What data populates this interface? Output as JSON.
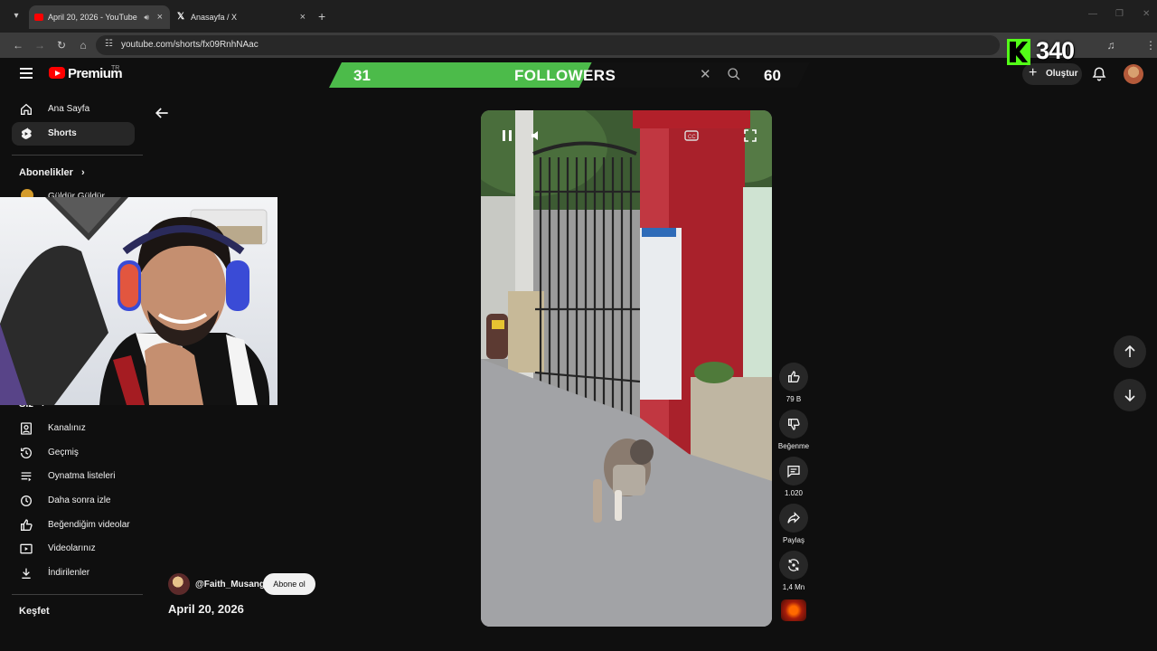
{
  "browser": {
    "tabs": [
      {
        "title": "April 20, 2026 - YouTube",
        "close": "×"
      },
      {
        "title": "Anasayfa / X",
        "close": "×"
      }
    ],
    "new_tab": "+",
    "url": "youtube.com/shorts/fx09RnhNAac"
  },
  "header": {
    "brand": "Premium",
    "country": "TR",
    "create_label": "Oluştur"
  },
  "sidebar": {
    "main_items": [
      {
        "label": "Ana Sayfa",
        "icon": "home-icon"
      },
      {
        "label": "Shorts",
        "icon": "shorts-icon"
      }
    ],
    "subscriptions_title": "Abonelikler",
    "subscription_partial": "Güldür Güldür",
    "you_title": "Siz",
    "you_items": [
      {
        "label": "Kanalınız",
        "icon": "channel-icon"
      },
      {
        "label": "Geçmiş",
        "icon": "history-icon"
      },
      {
        "label": "Oynatma listeleri",
        "icon": "playlist-icon"
      },
      {
        "label": "Daha sonra izle",
        "icon": "clock-icon"
      },
      {
        "label": "Beğendiğim videolar",
        "icon": "thumbs-up-icon"
      },
      {
        "label": "Videolarınız",
        "icon": "video-icon"
      },
      {
        "label": "İndirilenler",
        "icon": "download-icon"
      }
    ],
    "explore_title": "Keşfet"
  },
  "overlay": {
    "followers_current": "31",
    "followers_label": "FOLLOWERS",
    "followers_goal": "60",
    "followers_progress": 0.52,
    "kick_viewers": "340"
  },
  "short": {
    "channel": "@Faith_Musangi",
    "subscribe_label": "Abone ol",
    "title": "April 20, 2026",
    "likes": "79 B",
    "dislike_label": "Beğenme",
    "comments": "1.020",
    "share_label": "Paylaş",
    "remix_count": "1,4 Mn"
  },
  "colors": {
    "youtube_red": "#ff0000",
    "kick_green": "#53fc18",
    "followers_green": "#4cbb4a",
    "background": "#0f0f0f"
  }
}
